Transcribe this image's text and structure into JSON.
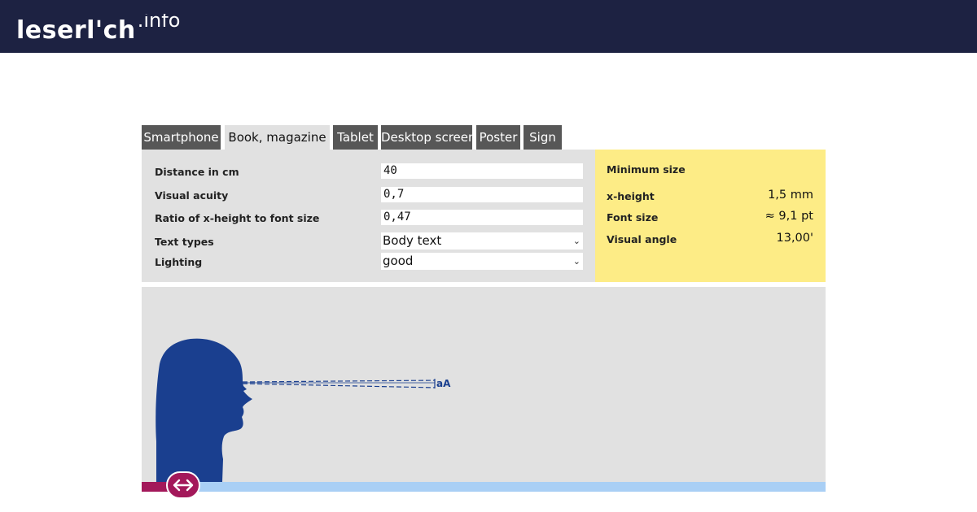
{
  "header": {
    "logo_main": "leserl'ch",
    "logo_suffix": ".info"
  },
  "tabs": [
    {
      "label": "Smartphone",
      "active": false
    },
    {
      "label": "Book, magazine",
      "active": true
    },
    {
      "label": "Tablet",
      "active": false
    },
    {
      "label": "Desktop screen",
      "active": false
    },
    {
      "label": "Poster",
      "active": false
    },
    {
      "label": "Sign",
      "active": false
    }
  ],
  "form": {
    "distance": {
      "label": "Distance in cm",
      "value": "40"
    },
    "acuity": {
      "label": "Visual acuity",
      "value": "0,7"
    },
    "ratio": {
      "label": "Ratio of x-height to font size",
      "value": "0,47"
    },
    "text_types": {
      "label": "Text types",
      "selected": "Body text"
    },
    "lighting": {
      "label": "Lighting",
      "selected": "good"
    }
  },
  "result": {
    "title": "Minimum size",
    "xheight": {
      "label": "x-height",
      "value": "1,5 mm"
    },
    "font_size": {
      "label": "Font size",
      "value": "≈ 9,1 pt"
    },
    "visual_angle": {
      "label": "Visual angle",
      "value": "13,00'"
    }
  },
  "visualization": {
    "sample_text": "aA",
    "head_color": "#1a3f8f",
    "slider_position": 0.04
  },
  "colors": {
    "header_bg": "#1d2242",
    "tab_bg": "#575757",
    "panel_bg": "#e1e1e1",
    "result_bg": "#fdec86",
    "accent": "#a3185a",
    "track_light": "#a9cff5"
  }
}
